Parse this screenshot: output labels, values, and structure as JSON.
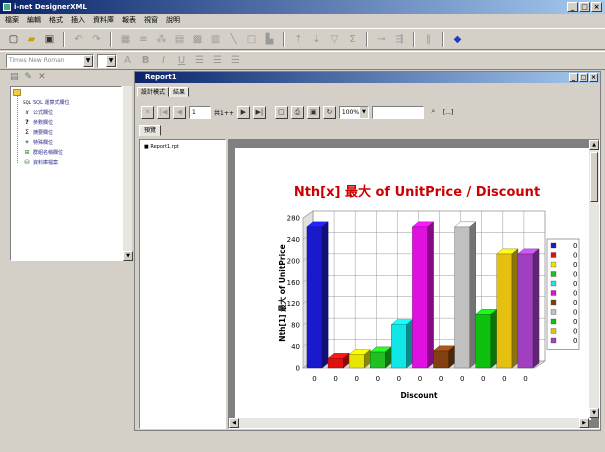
{
  "window": {
    "title": "i-net DesignerXML"
  },
  "menu": [
    "檔案",
    "編輯",
    "格式",
    "插入",
    "資料庫",
    "報表",
    "視窗",
    "說明"
  ],
  "font_combo": {
    "value": "Times New Roman"
  },
  "tree": {
    "items": [
      {
        "label": "",
        "icon": "folder-icon"
      },
      {
        "label": "SQL 運算式欄位",
        "icon": "sql-icon"
      },
      {
        "label": "公式欄位",
        "icon": "formula-icon"
      },
      {
        "label": "參數欄位",
        "icon": "question-icon"
      },
      {
        "label": "摘要欄位",
        "icon": "sigma-icon"
      },
      {
        "label": "特殊欄位",
        "icon": "special-icon"
      },
      {
        "label": "群組名稱欄位",
        "icon": "group-icon"
      },
      {
        "label": "資料庫檔案",
        "icon": "database-icon"
      }
    ]
  },
  "child": {
    "title": "Report1",
    "tabs": [
      "設計模式",
      "結果"
    ],
    "page_input": "1",
    "page_of": "共1++",
    "zoom": "100%",
    "search_extra": "[...]",
    "preview_tab": "預覽",
    "file": "Report1.rpt"
  },
  "chart_data": {
    "type": "bar",
    "title": "Nth[x] 最大 of UnitPrice / Discount",
    "xlabel": "Discount",
    "ylabel": "Nth[1] 最大 of UnitPrice",
    "ylim": [
      0,
      280
    ],
    "yticks": [
      0,
      40,
      80,
      120,
      160,
      200,
      240,
      280
    ],
    "yticklabels": [
      "0",
      "40",
      "80",
      "120",
      "160",
      "200",
      "240",
      "280"
    ],
    "categories": [
      "0",
      "0",
      "0",
      "0",
      "0",
      "0",
      "0",
      "0",
      "0",
      "0",
      "0"
    ],
    "values": [
      263.5,
      18,
      25,
      30,
      81,
      263.5,
      32,
      263.5,
      100,
      213,
      213
    ],
    "colors": [
      "#1a1acc",
      "#e01010",
      "#e6e600",
      "#20c020",
      "#10e8e8",
      "#e010e0",
      "#804010",
      "#c0c0c0",
      "#10c010",
      "#e6c010",
      "#a040c0"
    ],
    "legend": {
      "position": "right",
      "labels": [
        "0",
        "0",
        "0",
        "0",
        "0",
        "0",
        "0",
        "0",
        "0",
        "0",
        "0"
      ],
      "colors": [
        "#1a1acc",
        "#e01010",
        "#e6e600",
        "#20c020",
        "#10e8e8",
        "#e010e0",
        "#804010",
        "#c0c0c0",
        "#10c010",
        "#e6c010",
        "#a040c0"
      ]
    },
    "grid": true,
    "title_color": "#cc0000"
  }
}
